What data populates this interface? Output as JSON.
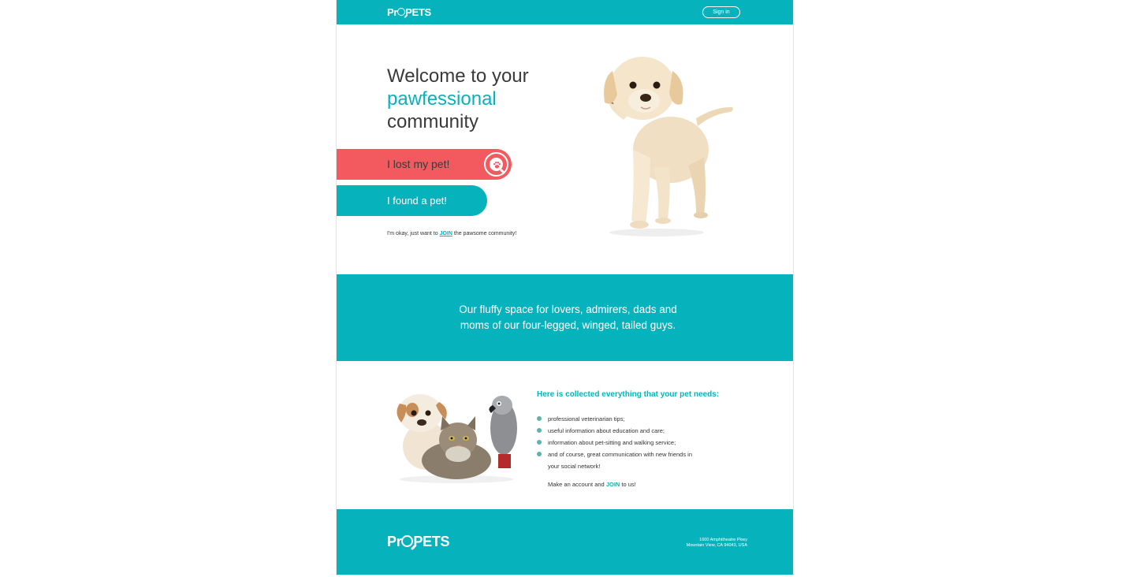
{
  "header": {
    "logo_prefix": "Pr",
    "logo_suffix": "PETS",
    "signin_label": "Sign in"
  },
  "hero": {
    "title_line1": "Welcome to your",
    "title_accent": "pawfessional",
    "title_line3": "community",
    "lost_button_label": "I lost my pet!",
    "found_button_label": "I found a pet!",
    "join_prefix": "I'm okay, just want to",
    "join_link": "JOIN",
    "join_suffix": "the pawsome community!"
  },
  "band": {
    "line1": "Our fluffy space for lovers, admirers, dads and",
    "line2": "moms of our four-legged, winged, tailed guys."
  },
  "features": {
    "title": "Here is collected everything that your pet needs:",
    "items": [
      "professional veterinarian tips;",
      "useful information about education and care;",
      "information about pet-sitting and walking service;",
      "and of course, great communication with new friends in your social network!"
    ],
    "cta_prefix": "Make an account and",
    "cta_link": "JOIN",
    "cta_suffix": "to us!"
  },
  "footer": {
    "logo_prefix": "Pr",
    "logo_suffix": "PETS",
    "address_line1": "1600 Amphitheatre Pkwy",
    "address_line2": "Mountain View, CA 94043, USA"
  },
  "colors": {
    "brand_teal": "#06b2bc",
    "lost_red": "#f25a5f",
    "bullet": "#5fb3a9"
  },
  "icons": {
    "logo_o": "magnifier-paw-icon",
    "lost_badge": "paw-search-icon"
  }
}
